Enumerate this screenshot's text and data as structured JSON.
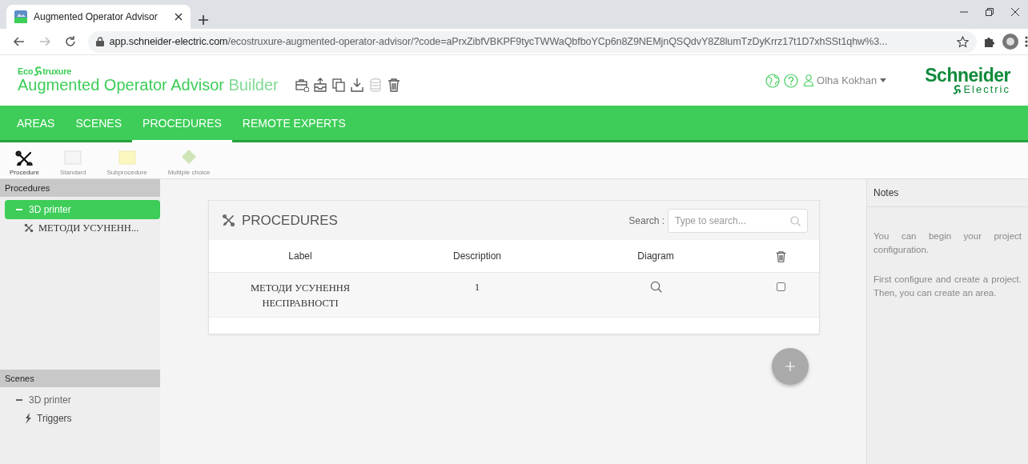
{
  "browser": {
    "tab_title": "Augmented Operator Advisor",
    "url": {
      "host": "app.schneider-electric.com",
      "path": "/ecostruxure-augmented-operator-advisor/?code=aPrxZibfVBKPF9tycTWWaQbfboYCp6n8Z9NEMjnQSQdvY8Z8lumTzDyKrrz17t1D7xhSSt1qhw%3..."
    }
  },
  "header": {
    "brand": {
      "prefix": "Eco",
      "suffix": "truxure"
    },
    "title": "Augmented Operator Advisor",
    "subtitle": "Builder",
    "toolbar": [
      {
        "kind": "new",
        "disabled": false
      },
      {
        "kind": "import",
        "disabled": false
      },
      {
        "kind": "copy",
        "disabled": false
      },
      {
        "kind": "download",
        "disabled": false
      },
      {
        "kind": "database",
        "disabled": true
      },
      {
        "kind": "delete",
        "disabled": false
      }
    ],
    "user": "Olha Kokhan",
    "logo": {
      "name": "Schneider",
      "tagline": "Electric"
    }
  },
  "nav": {
    "tabs": [
      {
        "label": "AREAS",
        "selected": false
      },
      {
        "label": "SCENES",
        "selected": false
      },
      {
        "label": "PROCEDURES",
        "selected": true
      },
      {
        "label": "REMOTE EXPERTS",
        "selected": false
      }
    ]
  },
  "palette": [
    {
      "kind": "procedure",
      "label": "Procedure",
      "disabled": false
    },
    {
      "kind": "standard",
      "label": "Standard",
      "disabled": true
    },
    {
      "kind": "subprocedure",
      "label": "Subprocedure",
      "disabled": true
    },
    {
      "kind": "choice",
      "label": "Multiple choice",
      "disabled": true
    }
  ],
  "sidebar": {
    "sections": [
      {
        "title": "Procedures",
        "items": [
          {
            "label": "3D printer",
            "expanded": true,
            "selected": true,
            "children": [
              {
                "label": "МЕТОДИ УСУНЕНН...",
                "kind": "procedure",
                "selected": false
              }
            ]
          }
        ]
      },
      {
        "title": "Scenes",
        "items": [
          {
            "label": "3D printer",
            "expanded": true,
            "selected": false,
            "children": [
              {
                "label": "Triggers",
                "kind": "trigger",
                "selected": false
              }
            ]
          }
        ]
      }
    ]
  },
  "procedures": {
    "title": "PROCEDURES",
    "search": {
      "label": "Search :",
      "placeholder": "Type to search..."
    },
    "columns": [
      "Label",
      "Description",
      "Diagram"
    ],
    "rows": [
      {
        "label": "МЕТОДИ УСУНЕННЯ НЕСПРАВНОСТІ",
        "description": "1",
        "checked": false
      }
    ]
  },
  "notes": {
    "title": "Notes",
    "paragraphs": [
      "You can begin your project configuration.",
      "First configure and create a project. Then, you can create an area."
    ]
  }
}
